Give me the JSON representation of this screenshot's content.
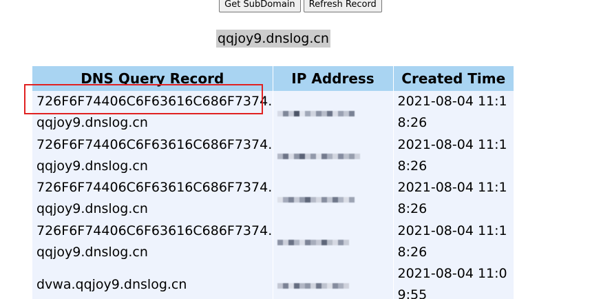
{
  "buttons": {
    "get_subdomain": "Get SubDomain",
    "refresh_record": "Refresh Record"
  },
  "subdomain": "qqjoy9.dnslog.cn",
  "table": {
    "headers": [
      "DNS Query Record",
      "IP Address",
      "Created Time"
    ],
    "rows": [
      {
        "record": "726F6F74406C6F63616C686F7374.qqjoy9.dnslog.cn",
        "ip": "[blurred]",
        "time": "2021-08-04 11:18:26"
      },
      {
        "record": "726F6F74406C6F63616C686F7374.qqjoy9.dnslog.cn",
        "ip": "[blurred]",
        "time": "2021-08-04 11:18:26"
      },
      {
        "record": "726F6F74406C6F63616C686F7374.qqjoy9.dnslog.cn",
        "ip": "[blurred]",
        "time": "2021-08-04 11:18:26"
      },
      {
        "record": "726F6F74406C6F63616C686F7374.qqjoy9.dnslog.cn",
        "ip": "[blurred]",
        "time": "2021-08-04 11:18:26"
      },
      {
        "record": "dvwa.qqjoy9.dnslog.cn",
        "ip": "[blurred]",
        "time": "2021-08-04 11:09:55"
      }
    ]
  },
  "colors": {
    "header_bg": "#a9d4f2",
    "row_bg": "#eef3fd",
    "highlight_border": "#e02020",
    "domain_bg": "#cccccc"
  }
}
